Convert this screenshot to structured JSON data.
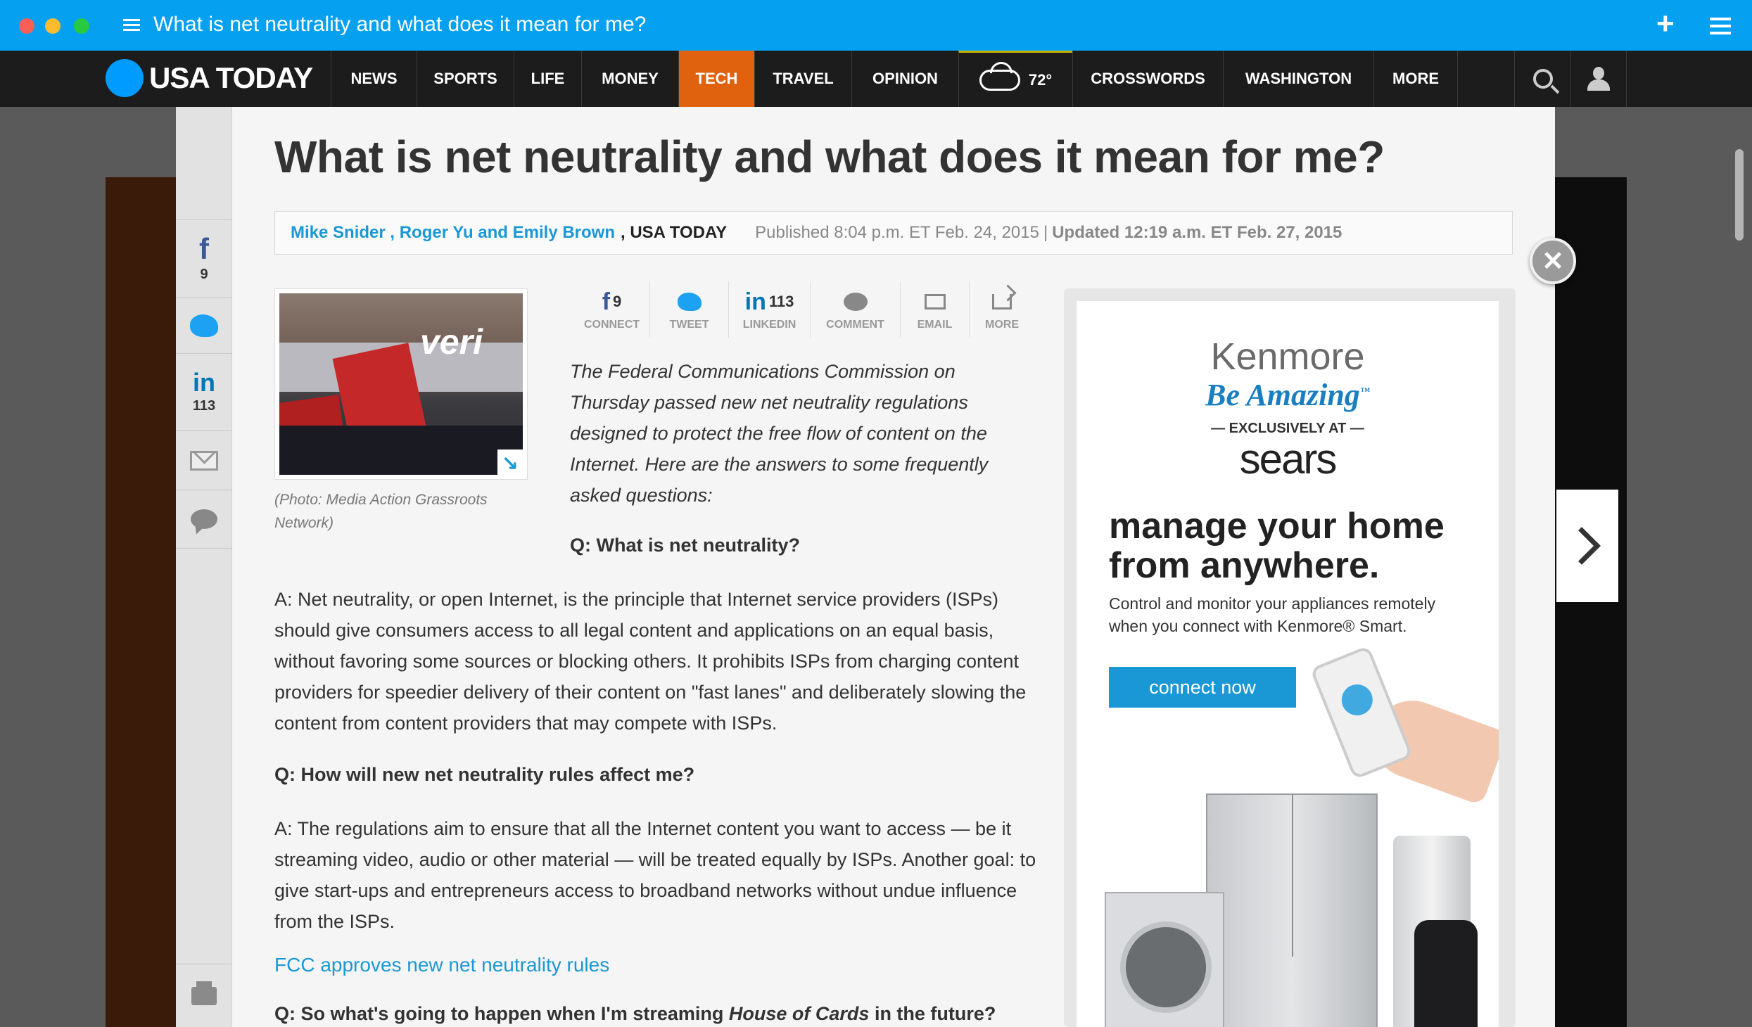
{
  "window": {
    "title": "What is net neutrality and what does it mean for me?",
    "plus_label": "+"
  },
  "nav": {
    "logo": "USA TODAY",
    "items": [
      "NEWS",
      "SPORTS",
      "LIFE",
      "MONEY",
      "TECH",
      "TRAVEL",
      "OPINION"
    ],
    "active_item": "TECH",
    "weather_temp": "72°",
    "items_right": [
      "CROSSWORDS",
      "WASHINGTON",
      "MORE"
    ],
    "colors": {
      "bar": "#1c1c1c",
      "active": "#e0620f",
      "titlebar": "#05a1f0"
    }
  },
  "share_rail": {
    "facebook_count": "9",
    "linkedin_count": "113"
  },
  "article": {
    "headline": "What is net neutrality and what does it mean for me?",
    "byline": {
      "authors": "Mike Snider , Roger Yu and Emily Brown",
      "outlet": ", USA TODAY",
      "published": "Published 8:04 p.m. ET Feb. 24, 2015",
      "separator": "|",
      "updated": "Updated 12:19 a.m. ET Feb. 27, 2015"
    },
    "photo_caption": "(Photo: Media Action Grassroots Network)",
    "photo_sign_text": "veri",
    "share_bar": [
      {
        "label": "CONNECT",
        "count": "9"
      },
      {
        "label": "TWEET",
        "count": ""
      },
      {
        "label": "LINKEDIN",
        "count": "113"
      },
      {
        "label": "COMMENT",
        "count": ""
      },
      {
        "label": "EMAIL",
        "count": ""
      },
      {
        "label": "MORE",
        "count": ""
      }
    ],
    "summary": "The Federal Communications Commission on Thursday passed new net neutrality regulations designed to protect the free flow of content on the Internet. Here are the answers to some frequently asked questions:",
    "q1": "Q: What is net neutrality?",
    "a1": "A: Net neutrality, or open Internet, is the principle that Internet service providers (ISPs) should give consumers access to all legal content and applications on an equal basis, without favoring some sources or blocking others. It prohibits ISPs from charging content providers for speedier delivery of their content on \"fast lanes\" and deliberately slowing the content from content providers that may compete with ISPs.",
    "q2": "Q: How will new net neutrality rules affect me?",
    "a2": "A: The regulations aim to ensure that all the Internet content you want to access — be it streaming video, audio or other material — will be treated equally by ISPs. Another goal: to give start-ups and entrepreneurs access to broadband networks without undue influence from the ISPs.",
    "related_link": "FCC approves new net neutrality rules",
    "q3_before": "Q: So what's going to happen when I'm streaming ",
    "q3_title": "House of Cards",
    "q3_after": " in the future?"
  },
  "ad": {
    "brand": "Kenmore",
    "tagline": "Be Amazing",
    "tagline_mark": "™",
    "exclusive": "— EXCLUSIVELY AT —",
    "retailer": "sears",
    "headline": "manage your home from anywhere.",
    "body": "Control and monitor your appliances remotely when you connect with Kenmore® Smart.",
    "cta": "connect now"
  },
  "close_symbol": "✕",
  "expand_symbol": "↘"
}
